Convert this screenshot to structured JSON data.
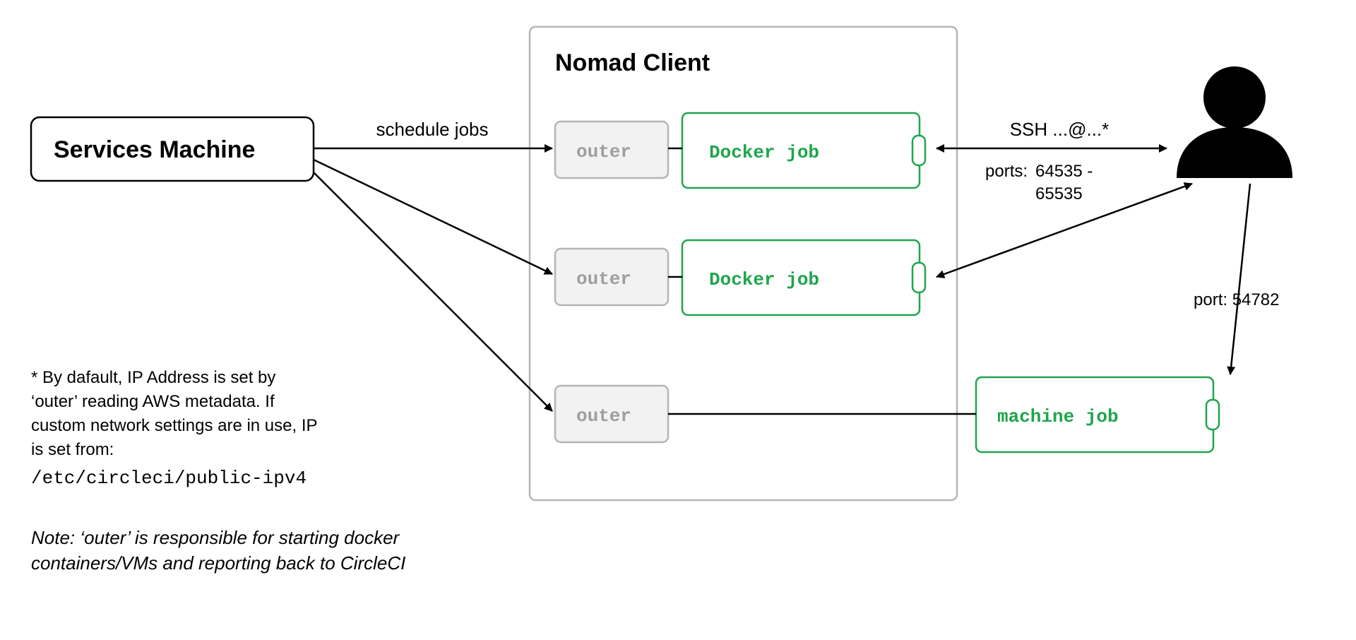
{
  "services_machine": "Services Machine",
  "schedule_label": "schedule jobs",
  "nomad_client": "Nomad Client",
  "outer_label": "outer",
  "docker_job": "Docker job",
  "machine_job": "machine job",
  "ssh_label": "SSH ...@...*",
  "ports_label": "ports:",
  "ports_value1": "64535 -",
  "ports_value2": "65535",
  "port2_label": "port: 54782",
  "footnote": {
    "l1": "* By dafault, IP Address is set by",
    "l2": "‘outer’ reading AWS metadata. If",
    "l3": "custom network settings are in use, IP",
    "l4": "is set from:",
    "l5": "/etc/circleci/public-ipv4"
  },
  "note": {
    "l1": "Note: ‘outer’ is responsible for starting docker",
    "l2": "containers/VMs and reporting back to CircleCI"
  }
}
